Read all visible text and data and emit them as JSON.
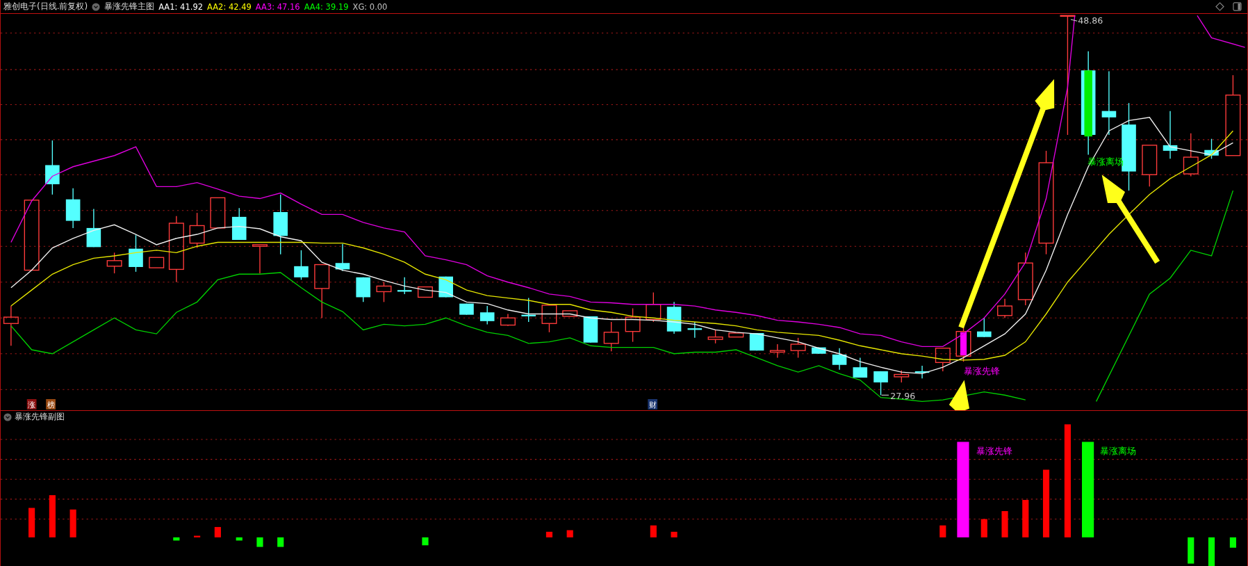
{
  "header": {
    "title": "雅创电子(日线.前复权)",
    "indicator": "暴涨先锋主图",
    "values": [
      {
        "label": "AA1: 41.92",
        "color": "#ffffff"
      },
      {
        "label": "AA2: 42.49",
        "color": "#ffff00"
      },
      {
        "label": "AA3: 47.16",
        "color": "#ff00ff"
      },
      {
        "label": "AA4: 39.19",
        "color": "#00ff00"
      },
      {
        "label": "XG: 0.00",
        "color": "#c0c0c0"
      }
    ]
  },
  "main_chart": {
    "high_label": "48.86",
    "low_label": "27.96",
    "signals": [
      {
        "text": "暴涨先锋",
        "kind": "entry"
      },
      {
        "text": "暴涨离场",
        "kind": "exit"
      }
    ],
    "badges": [
      {
        "text": "涨",
        "color": "#8b1010"
      },
      {
        "text": "榜",
        "color": "#9a4a12"
      },
      {
        "text": "财",
        "color": "#1a3570"
      }
    ]
  },
  "sub_panel": {
    "title": "暴涨先锋副图",
    "signals": [
      {
        "text": "暴涨先锋",
        "kind": "entry"
      },
      {
        "text": "暴涨离场",
        "kind": "exit"
      }
    ]
  }
}
